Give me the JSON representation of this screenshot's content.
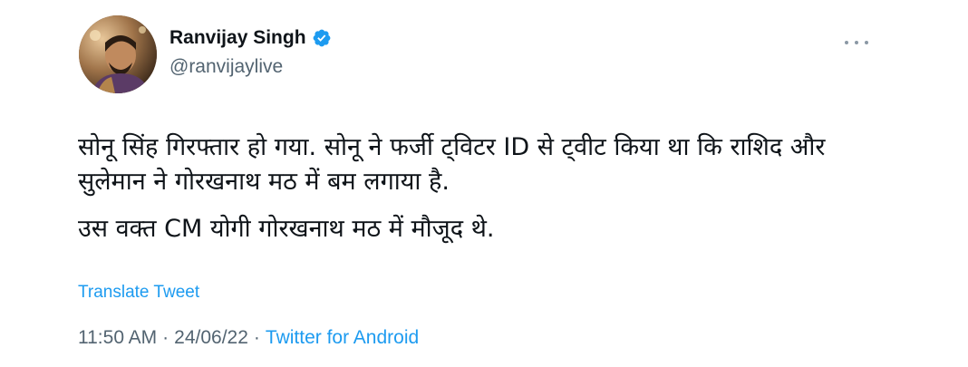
{
  "author": {
    "display_name": "Ranvijay Singh",
    "handle": "@ranvijaylive",
    "verified": true
  },
  "tweet": {
    "paragraphs": [
      "सोनू सिंह गिरफ्तार हो गया. सोनू ने फर्जी ट्विटर ID से ट्वीट किया था कि राशिद और सुलेमान ने गोरखनाथ मठ में बम लगाया है.",
      "उस वक्त CM योगी गोरखनाथ मठ में मौजूद थे."
    ],
    "translate_label": "Translate Tweet"
  },
  "meta": {
    "time": "11:50 AM",
    "date": "24/06/22",
    "separator": "·",
    "source": "Twitter for Android"
  },
  "icons": {
    "verified": "verified-badge-icon",
    "more": "more-options-icon"
  },
  "colors": {
    "accent": "#1d9bf0",
    "text": "#0f1419",
    "muted": "#536471"
  }
}
